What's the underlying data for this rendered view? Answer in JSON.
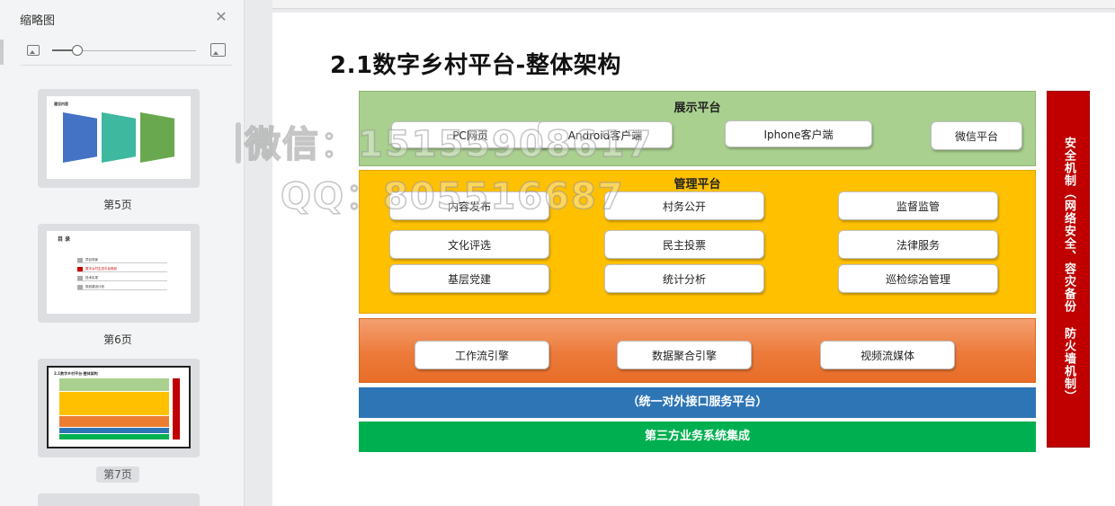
{
  "sidebar": {
    "title": "缩略图",
    "close_icon": "close-icon",
    "thumbnails": [
      {
        "page_label": "第5页",
        "mini_title": "建设内容",
        "selected": false
      },
      {
        "page_label": "第6页",
        "mini_title": "目 录",
        "items": [
          "项目背景",
          "数字乡村生态平台规划",
          "技术实现",
          "规划建设计划"
        ],
        "active_item": 2,
        "selected": false
      },
      {
        "page_label": "第7页",
        "mini_title": "2.1数字乡村平台-整体架构",
        "selected": true
      }
    ]
  },
  "slide": {
    "title": "2.1数字乡村平台-整体架构",
    "display_layer": {
      "title": "展示平台",
      "items": [
        "PC网页",
        "Android客户端",
        "Iphone客户端",
        "微信平台"
      ]
    },
    "management_layer": {
      "title": "管理平台",
      "items": [
        "内容发布",
        "村务公开",
        "监督监管",
        "文化评选",
        "民主投票",
        "法律服务",
        "基层党建",
        "统计分析",
        "巡检综治管理"
      ]
    },
    "engine_layer": {
      "items": [
        "工作流引擎",
        "数据聚合引擎",
        "视频流媒体"
      ]
    },
    "interface_bar": "（统一对外接口服务平台）",
    "integration_bar": "第三方业务系统集成",
    "security": "安全机制（网络安全、容灾备份 防火墙机制）",
    "colors": {
      "display": "#a9d08e",
      "management": "#ffc000",
      "engine": "#ed7d31",
      "interface": "#2e75b6",
      "integration": "#00b050",
      "security": "#c00000"
    }
  },
  "watermark": {
    "line1": "微信：15155908617",
    "line2": "QQ：805516687"
  }
}
